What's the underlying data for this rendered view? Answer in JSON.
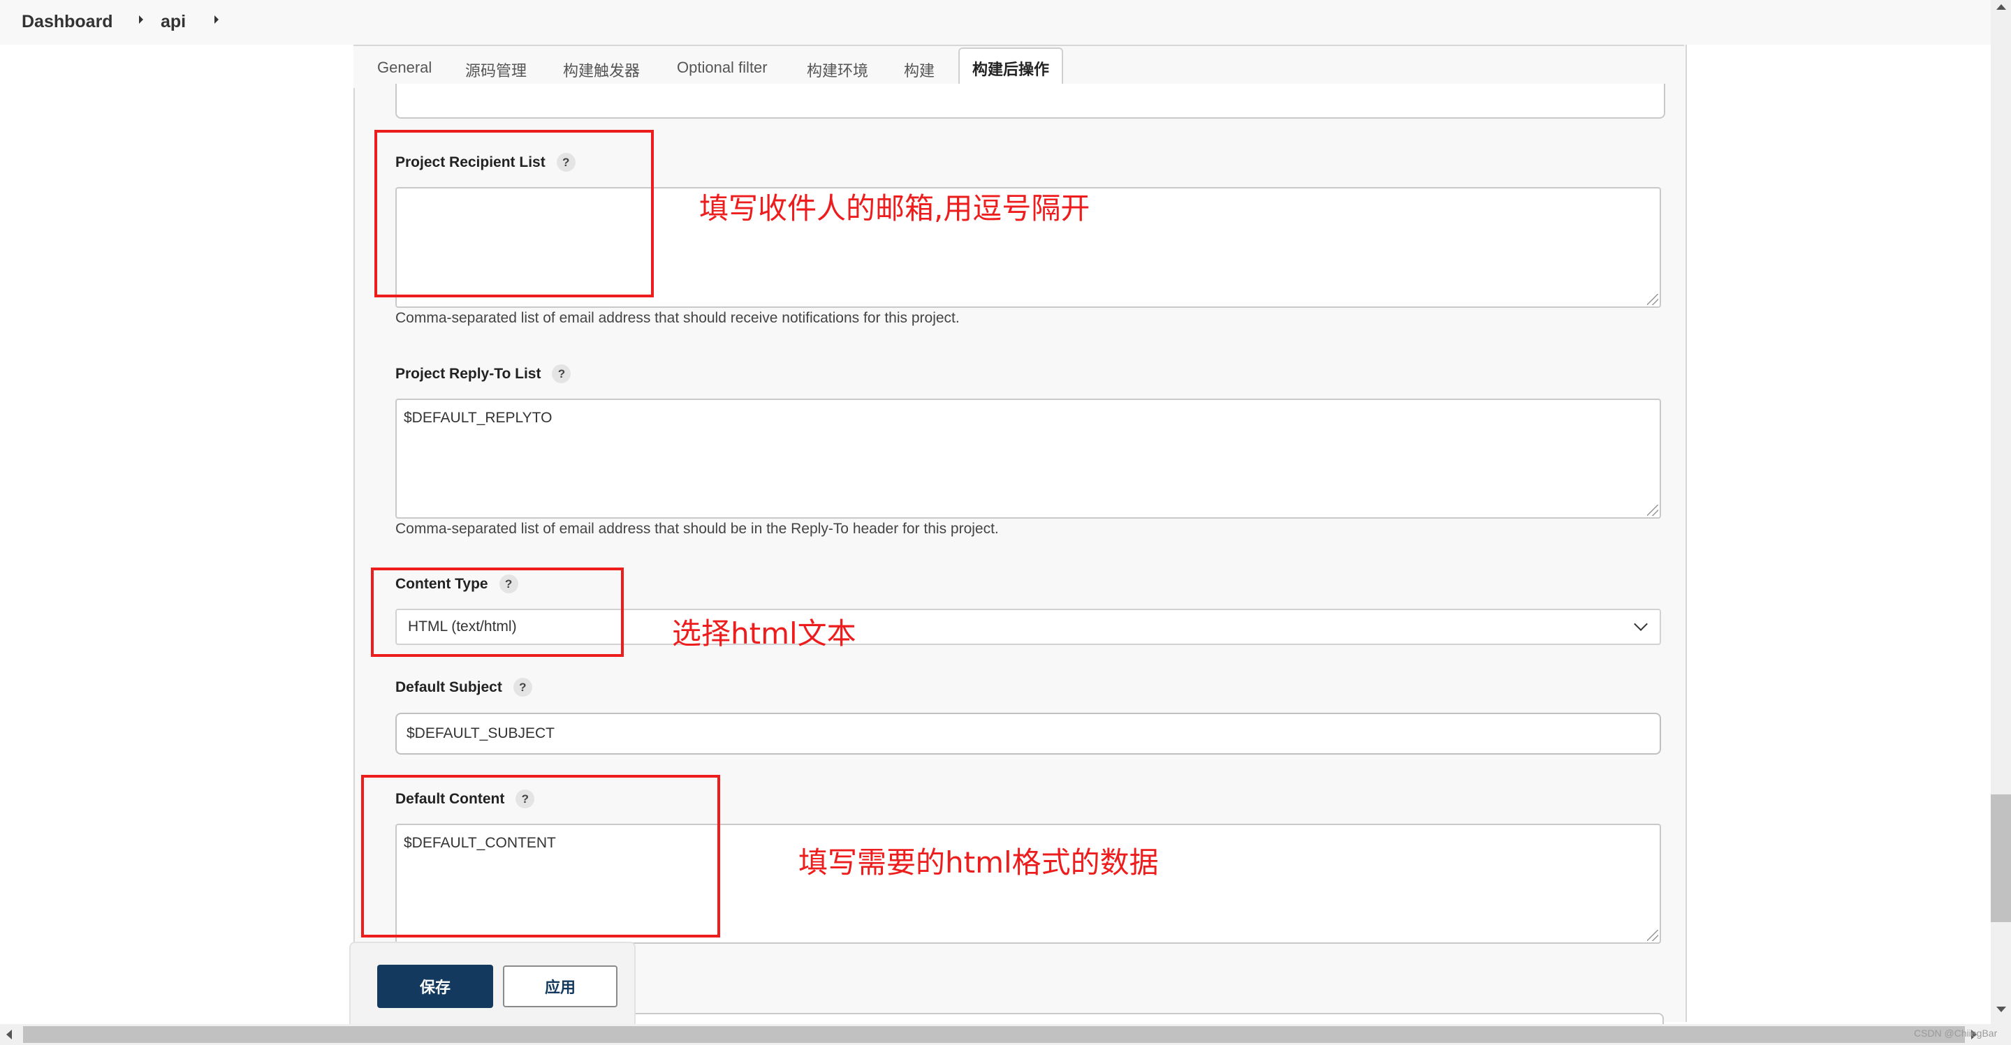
{
  "breadcrumb": {
    "dashboard": "Dashboard",
    "project": "api"
  },
  "tabs": [
    "General",
    "源码管理",
    "构建触发器",
    "Optional filter",
    "构建环境",
    "构建"
  ],
  "active_tab": "构建后操作",
  "fields": {
    "recipient": {
      "label": "Project Recipient List",
      "value": "",
      "desc": "Comma-separated list of email address that should receive notifications for this project."
    },
    "reply_to": {
      "label": "Project Reply-To List",
      "value": "$DEFAULT_REPLYTO",
      "desc": "Comma-separated list of email address that should be in the Reply-To header for this project."
    },
    "content_type": {
      "label": "Content Type",
      "value": "HTML (text/html)"
    },
    "subject": {
      "label": "Default Subject",
      "value": "$DEFAULT_SUBJECT"
    },
    "content": {
      "label": "Default Content",
      "value": "$DEFAULT_CONTENT"
    },
    "help_glyph": "?"
  },
  "annotations": {
    "recipient": "填写收件人的邮箱,用逗号隔开",
    "content_type": "选择html文本",
    "content": "填写需要的html格式的数据"
  },
  "buttons": {
    "save": "保存",
    "apply": "应用"
  },
  "watermark": "CSDN @ChiiegBar",
  "colors": {
    "annotation_red": "#ee1d1d",
    "primary_button": "#133a5e"
  }
}
